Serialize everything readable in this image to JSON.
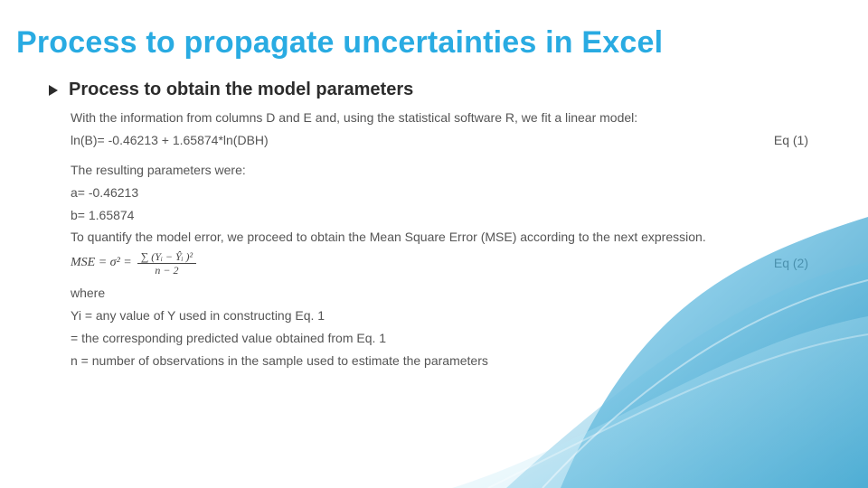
{
  "title": "Process to propagate uncertainties in Excel",
  "subheading": "Process to obtain the model parameters",
  "intro": "With the information from columns D and E and, using the statistical software R, we fit a linear model:",
  "eq1_text": "ln(B)= -0.46213 + 1.65874*ln(DBH)",
  "eq1_label": "Eq (1)",
  "params_intro": "The resulting parameters were:",
  "param_a": "a= -0.46213",
  "param_b": "b= 1.65874",
  "mse_intro": "To quantify the model error, we proceed to obtain the Mean Square Error (MSE) according to   the next expression.",
  "mse_left": "MSE  =  σ²  =",
  "mse_num": "∑ (Yᵢ − Ŷᵢ )²",
  "mse_den": "n − 2",
  "eq2_label": "Eq (2)",
  "where_label": "where",
  "where_yi": "Yi  = any value of Y used in constructing Eq. 1",
  "where_yhat": " = the corresponding predicted value obtained from Eq. 1",
  "where_n": "n = number of observations in the sample used to estimate the parameters"
}
